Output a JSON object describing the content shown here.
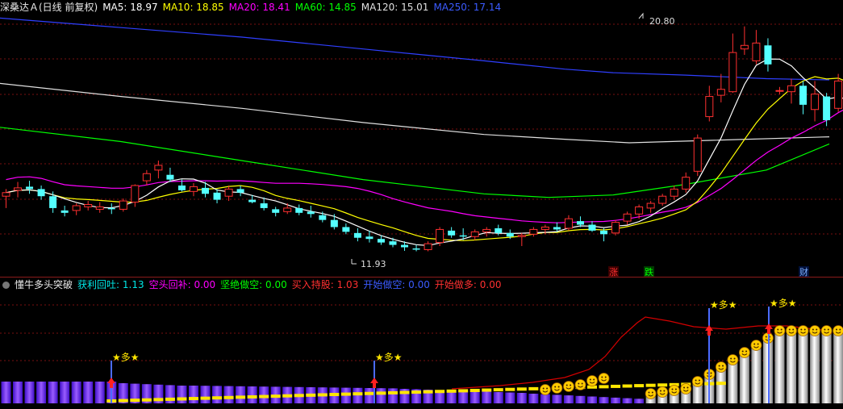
{
  "main_header": {
    "title": "深桑达Ａ(日线 前复权)",
    "ma_items": [
      {
        "label": "MA5: 18.97",
        "color": "#ffffff"
      },
      {
        "label": "MA10: 18.85",
        "color": "#ffff00"
      },
      {
        "label": "MA20: 18.41",
        "color": "#ff00ff"
      },
      {
        "label": "MA60: 14.85",
        "color": "#00ff00"
      },
      {
        "label": "MA120: 15.01",
        "color": "#e0e0e0"
      },
      {
        "label": "MA250: 17.14",
        "color": "#3b5bff"
      }
    ]
  },
  "indicator_header": {
    "title": "懂牛多头突破",
    "items": [
      {
        "label": "获利回吐: 1.13",
        "color": "#00e6e6"
      },
      {
        "label": "空头回补: 0.00",
        "color": "#ff00ff"
      },
      {
        "label": "坚绝做空: 0.00",
        "color": "#00ff00"
      },
      {
        "label": "买入持股: 1.03",
        "color": "#ff3030"
      },
      {
        "label": "开始做空: 0.00",
        "color": "#3b5bff"
      },
      {
        "label": "开始做多: 0.00",
        "color": "#ff3030"
      }
    ]
  },
  "colors": {
    "up": "#ff3030",
    "down": "#54ffff",
    "ma5": "#ffffff",
    "ma10": "#ffff00",
    "ma20": "#ff00ff",
    "ma60": "#00ff00",
    "ma120": "#e0e0e0",
    "ma250": "#2f3fff",
    "grid": "#7a1010"
  },
  "annotations": {
    "high_label": "20.80",
    "low_label": "11.93"
  },
  "event_markers": [
    {
      "label": "涨",
      "color": "#ff3030",
      "bg": "#3a0000"
    },
    {
      "label": "跌",
      "color": "#00ff00",
      "bg": "#003a00"
    },
    {
      "label": "财",
      "color": "#7fb0ff",
      "bg": "#00103a"
    }
  ],
  "signal_label": "★多★",
  "chart_data": {
    "type": "candlestick",
    "price_range": [
      11.2,
      21.9
    ],
    "candles": [
      [
        14.25,
        14.55,
        13.75,
        14.4
      ],
      [
        14.5,
        14.85,
        14.2,
        14.6
      ],
      [
        14.65,
        14.9,
        14.35,
        14.55
      ],
      [
        14.55,
        14.7,
        14.1,
        14.25
      ],
      [
        14.25,
        14.45,
        13.55,
        13.75
      ],
      [
        13.65,
        13.85,
        13.4,
        13.55
      ],
      [
        13.65,
        13.95,
        13.45,
        13.85
      ],
      [
        13.8,
        14.05,
        13.65,
        13.9
      ],
      [
        13.7,
        14.0,
        13.55,
        13.8
      ],
      [
        13.75,
        13.95,
        13.5,
        13.7
      ],
      [
        13.7,
        14.15,
        13.6,
        14.05
      ],
      [
        14.0,
        14.75,
        13.8,
        14.7
      ],
      [
        14.9,
        15.35,
        14.7,
        15.2
      ],
      [
        15.35,
        15.75,
        15.0,
        15.55
      ],
      [
        15.15,
        15.45,
        14.85,
        14.95
      ],
      [
        14.7,
        14.95,
        14.45,
        14.5
      ],
      [
        14.45,
        14.8,
        14.25,
        14.65
      ],
      [
        14.6,
        14.85,
        14.2,
        14.35
      ],
      [
        14.4,
        14.55,
        13.95,
        14.1
      ],
      [
        14.25,
        14.7,
        14.05,
        14.55
      ],
      [
        14.55,
        14.7,
        14.25,
        14.4
      ],
      [
        14.1,
        14.3,
        13.95,
        14.0
      ],
      [
        13.95,
        14.2,
        13.65,
        13.75
      ],
      [
        13.7,
        13.8,
        13.4,
        13.55
      ],
      [
        13.6,
        13.95,
        13.5,
        13.75
      ],
      [
        13.75,
        13.9,
        13.45,
        13.55
      ],
      [
        13.6,
        13.85,
        13.35,
        13.5
      ],
      [
        13.45,
        13.6,
        13.15,
        13.25
      ],
      [
        13.25,
        13.5,
        12.85,
        12.95
      ],
      [
        12.95,
        13.1,
        12.65,
        12.75
      ],
      [
        12.7,
        12.9,
        12.35,
        12.5
      ],
      [
        12.55,
        12.8,
        12.3,
        12.45
      ],
      [
        12.45,
        12.6,
        12.2,
        12.3
      ],
      [
        12.35,
        12.5,
        12.1,
        12.2
      ],
      [
        12.2,
        12.35,
        11.95,
        12.1
      ],
      [
        12.05,
        12.2,
        11.93,
        12.0
      ],
      [
        12.0,
        12.35,
        11.93,
        12.25
      ],
      [
        12.3,
        12.95,
        12.15,
        12.85
      ],
      [
        12.8,
        12.95,
        12.5,
        12.6
      ],
      [
        12.6,
        12.9,
        12.4,
        12.55
      ],
      [
        12.55,
        12.85,
        12.4,
        12.75
      ],
      [
        12.75,
        12.95,
        12.55,
        12.85
      ],
      [
        12.9,
        13.05,
        12.6,
        12.7
      ],
      [
        12.7,
        12.85,
        12.45,
        12.55
      ],
      [
        12.55,
        12.7,
        12.15,
        12.6
      ],
      [
        12.65,
        12.95,
        12.55,
        12.85
      ],
      [
        12.85,
        13.05,
        12.65,
        12.95
      ],
      [
        12.95,
        13.15,
        12.75,
        12.85
      ],
      [
        12.9,
        13.45,
        12.8,
        13.3
      ],
      [
        13.2,
        13.4,
        12.95,
        13.05
      ],
      [
        13.05,
        13.2,
        12.75,
        12.8
      ],
      [
        12.8,
        12.9,
        12.35,
        12.65
      ],
      [
        12.7,
        13.25,
        12.6,
        13.15
      ],
      [
        13.2,
        13.6,
        13.05,
        13.5
      ],
      [
        13.5,
        13.9,
        13.3,
        13.8
      ],
      [
        13.75,
        14.05,
        13.55,
        13.95
      ],
      [
        13.95,
        14.35,
        13.85,
        14.25
      ],
      [
        14.25,
        14.7,
        14.1,
        14.55
      ],
      [
        14.55,
        15.25,
        14.4,
        15.05
      ],
      [
        15.3,
        16.85,
        15.1,
        16.7
      ],
      [
        17.6,
        18.9,
        17.4,
        18.45
      ],
      [
        18.5,
        19.4,
        18.2,
        18.75
      ],
      [
        18.65,
        21.1,
        18.6,
        20.3
      ],
      [
        20.45,
        21.4,
        20.2,
        20.6
      ],
      [
        19.95,
        21.25,
        19.8,
        20.7
      ],
      [
        20.6,
        20.9,
        19.5,
        19.8
      ],
      [
        18.7,
        18.85,
        18.55,
        18.7
      ],
      [
        18.65,
        19.2,
        18.15,
        18.9
      ],
      [
        18.9,
        19.1,
        17.7,
        18.1
      ],
      [
        17.9,
        19.1,
        17.4,
        18.55
      ],
      [
        18.45,
        18.6,
        17.2,
        17.45
      ],
      [
        17.95,
        19.4,
        17.8,
        19.1
      ],
      [
        18.9,
        19.15,
        18.3,
        18.35
      ],
      [
        18.2,
        19.15,
        17.95,
        19.0
      ],
      [
        19.0,
        20.45,
        18.7,
        20.0
      ],
      [
        20.25,
        21.1,
        20.0,
        20.65
      ],
      [
        20.2,
        20.65,
        19.85,
        20.25
      ],
      [
        20.1,
        20.5,
        19.85,
        20.2
      ],
      [
        20.25,
        21.0,
        20.05,
        20.75
      ],
      [
        20.35,
        21.3,
        20.15,
        21.2
      ],
      [
        21.25,
        21.6,
        20.7,
        20.95
      ],
      [
        21.1,
        21.85,
        20.75,
        21.55
      ],
      [
        20.75,
        21.4,
        20.5,
        20.85
      ],
      [
        20.75,
        21.65,
        20.55,
        21.15
      ],
      [
        21.25,
        21.85,
        20.7,
        21.5
      ],
      [
        21.4,
        21.85,
        20.3,
        20.2
      ]
    ]
  }
}
